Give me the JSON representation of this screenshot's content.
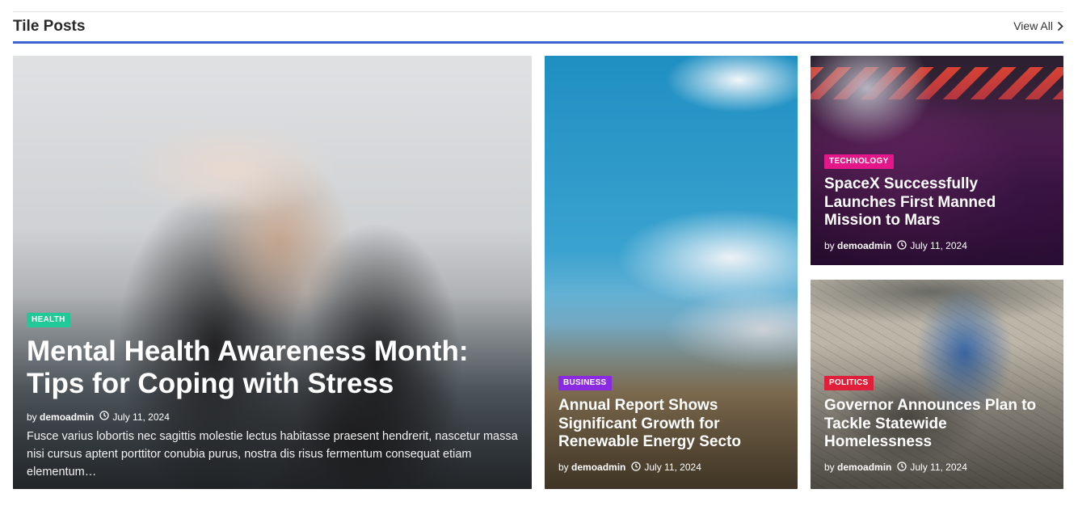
{
  "section": {
    "title": "Tile Posts",
    "view_all": "View All"
  },
  "colors": {
    "accent": "#3f63d3",
    "health": "#20c997",
    "business": "#8a2be2",
    "technology": "#e3168a",
    "politics": "#e0203a"
  },
  "posts": [
    {
      "category": "HEALTH",
      "title": "Mental Health Awareness Month: Tips for Coping with Stress",
      "by": "by",
      "author": "demoadmin",
      "date": "July 11, 2024",
      "excerpt": "Fusce varius lobortis nec sagittis molestie lectus habitasse praesent hendrerit, nascetur massa nisi cursus aptent porttitor conubia purus, nostra dis risus fermentum consequat etiam elementum…"
    },
    {
      "category": "BUSINESS",
      "title": "Annual Report Shows Significant Growth for Renewable Energy Secto",
      "by": "by",
      "author": "demoadmin",
      "date": "July 11, 2024"
    },
    {
      "category": "TECHNOLOGY",
      "title": "SpaceX Successfully Launches First Manned Mission to Mars",
      "by": "by",
      "author": "demoadmin",
      "date": "July 11, 2024"
    },
    {
      "category": "POLITICS",
      "title": "Governor Announces Plan to Tackle Statewide Homelessness",
      "by": "by",
      "author": "demoadmin",
      "date": "July 11, 2024"
    }
  ]
}
